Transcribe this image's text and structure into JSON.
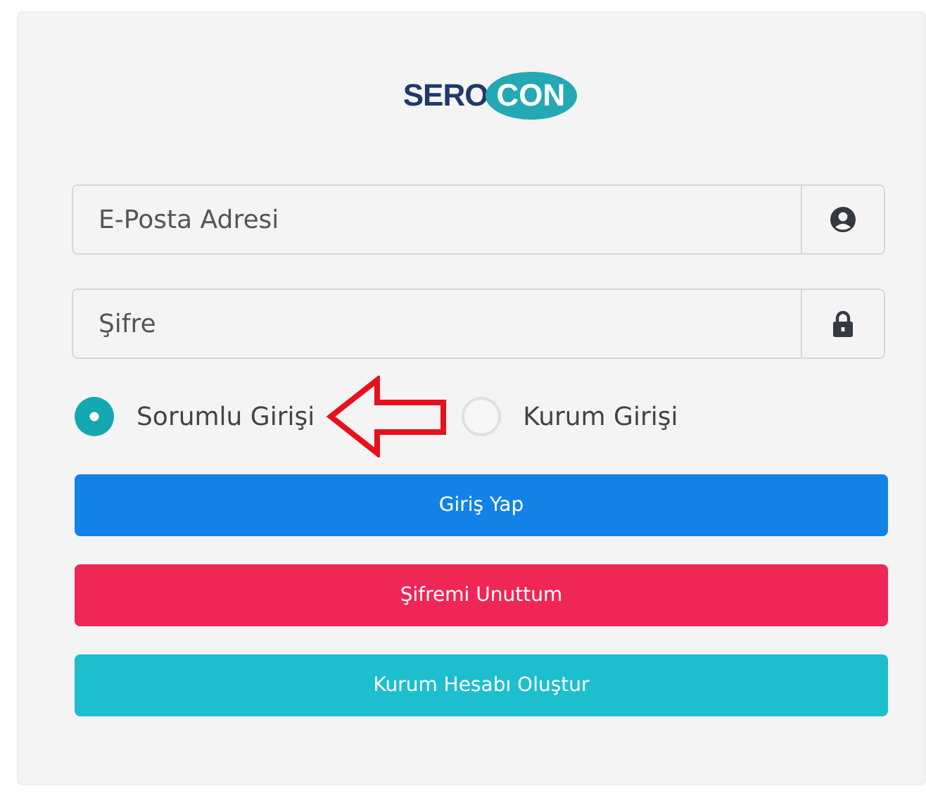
{
  "logo": {
    "part_1": "SERO",
    "part_2": "CON"
  },
  "fields": [
    {
      "placeholder": "E-Posta Adresi",
      "kind": "user"
    },
    {
      "placeholder": "Şifre",
      "kind": "lock"
    }
  ],
  "login_types": [
    {
      "label": "Sorumlu Girişi",
      "selected": true
    },
    {
      "label": "Kurum Girişi",
      "selected": false
    }
  ],
  "buttons": [
    {
      "label": "Giriş Yap",
      "color": "#1282e6"
    },
    {
      "label": "Şifremi Unuttum",
      "color": "#ef2656"
    },
    {
      "label": "Kurum Hesabı Oluştur",
      "color": "#1dbfcf"
    }
  ]
}
